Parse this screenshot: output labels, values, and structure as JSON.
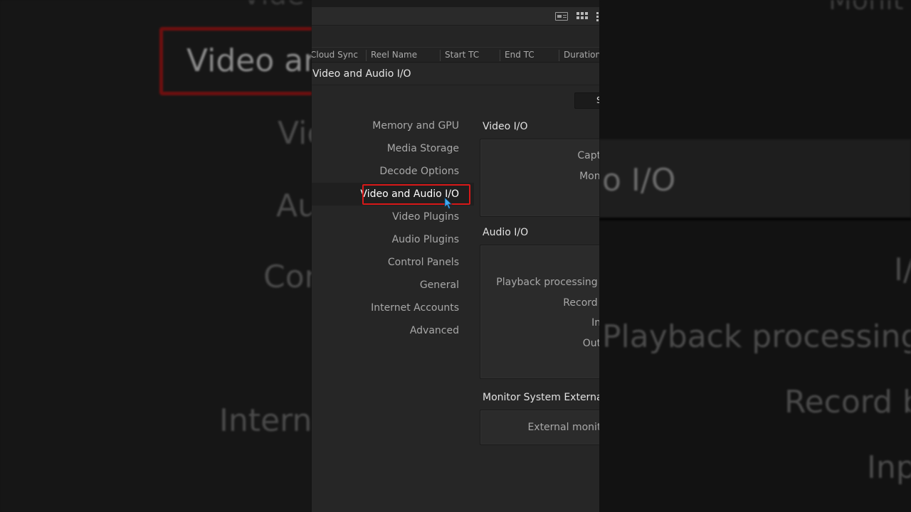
{
  "background": {
    "left_title_fragment": "Vide",
    "left_highlight": "Video and",
    "left_nav_fragments": [
      "Vid",
      "Au",
      "Con",
      "Interne"
    ],
    "right_title_fragment": "Monit",
    "right_highlight": "o I/O",
    "right_fragments": [
      "I/",
      "Playback processing b",
      "Record b",
      "Inp"
    ]
  },
  "columns": [
    "Cloud Sync",
    "Reel Name",
    "Start TC",
    "End TC",
    "Duration"
  ],
  "dialog": {
    "title": "Video and Audio I/O",
    "tab_stub_label": "S"
  },
  "nav": {
    "items": [
      "Memory and GPU",
      "Media Storage",
      "Decode Options",
      "Video and Audio I/O",
      "Video Plugins",
      "Audio Plugins",
      "Control Panels",
      "General",
      "Internet Accounts",
      "Advanced"
    ],
    "active_index": 3
  },
  "video_io": {
    "title": "Video I/O",
    "labels": [
      "Captu",
      "Monit"
    ]
  },
  "audio_io": {
    "title": "Audio I/O",
    "labels": [
      "I/",
      "Playback processing b",
      "Record b",
      "Inp",
      "Outp"
    ]
  },
  "monitor_ext": {
    "title": "Monitor System External In",
    "labels": [
      "External monito"
    ]
  },
  "colors": {
    "active_border": "#d81818",
    "cursor": "#3fa9f5"
  }
}
